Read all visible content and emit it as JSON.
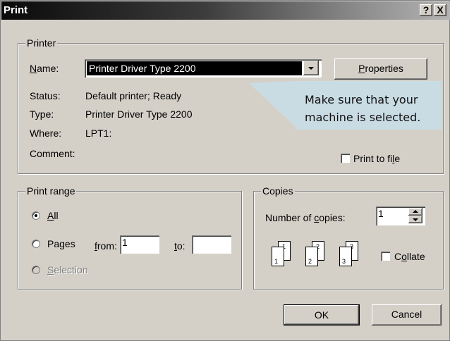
{
  "window": {
    "title": "Print",
    "help_glyph": "?",
    "close_glyph": "X"
  },
  "printer": {
    "group_label": "Printer",
    "name_label": "Name:",
    "name_value": "Printer Driver Type 2200",
    "properties_button": "Properties",
    "status_label": "Status:",
    "status_value": "Default printer; Ready",
    "type_label": "Type:",
    "type_value": "Printer Driver Type 2200",
    "where_label": "Where:",
    "where_value": "LPT1:",
    "comment_label": "Comment:",
    "print_to_file_label": "Print to file",
    "print_to_file_checked": false
  },
  "callout": {
    "line1": "Make sure that your",
    "line2": "machine is selected.",
    "background": "#c9dce4"
  },
  "print_range": {
    "group_label": "Print range",
    "all_label": "All",
    "pages_label": "Pages",
    "from_label": "from:",
    "from_value": "1",
    "to_label": "to:",
    "to_value": "",
    "selection_label": "Selection",
    "selected": "All"
  },
  "copies": {
    "group_label": "Copies",
    "number_label": "Number of copies:",
    "number_value": "1",
    "collate_label": "Collate",
    "collate_checked": false,
    "page_digits": [
      "1",
      "1",
      "2",
      "2",
      "3",
      "3"
    ]
  },
  "buttons": {
    "ok": "OK",
    "cancel": "Cancel"
  }
}
